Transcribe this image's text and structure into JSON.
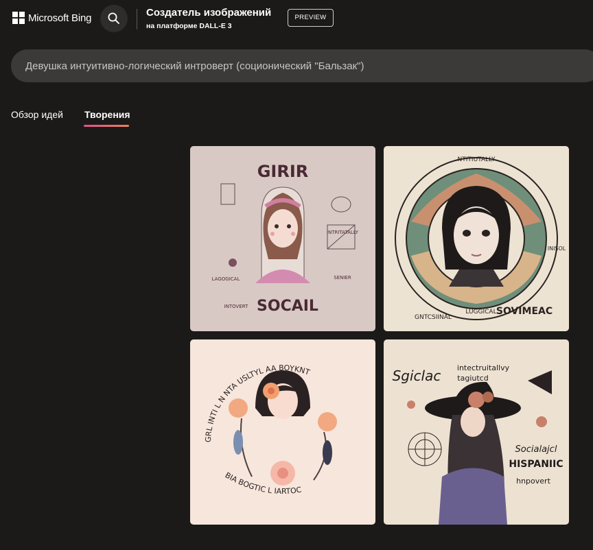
{
  "header": {
    "brand": "Microsoft Bing",
    "title": "Создатель изображений",
    "subtitle": "на платформе DALL-E 3",
    "preview_label": "PREVIEW"
  },
  "prompt": {
    "text": "Девушка интуитивно-логический интроверт (соционический \"Бальзак\")"
  },
  "tabs": [
    {
      "label": "Обзор идей",
      "active": false
    },
    {
      "label": "Творения",
      "active": true
    }
  ],
  "images": [
    {
      "words": [
        "GIRIR",
        "INTRITATALLY",
        "SOCAIL",
        "LAGOGICAL",
        "INTOVERT",
        "SENIER"
      ]
    },
    {
      "words": [
        "NTITIUTALLY",
        "SOVIMEAC",
        "GNTCSIINAL",
        "LUGGICAL",
        "INISOL"
      ]
    },
    {
      "words": [
        "GRL INTI L N NTA USLTYL AA BOYKNT",
        "BIA BOGTIC L IARTOC"
      ]
    },
    {
      "words": [
        "Sgiclac",
        "intectruitallvy",
        "tagiutcd",
        "Socialajcl",
        "HISPANIIC",
        "hnpovert"
      ]
    }
  ],
  "colors": {
    "background": "#1b1a19",
    "prompt_bg": "#3b3a39",
    "tab_underline": [
      "#e4518a",
      "#f0805a"
    ]
  }
}
